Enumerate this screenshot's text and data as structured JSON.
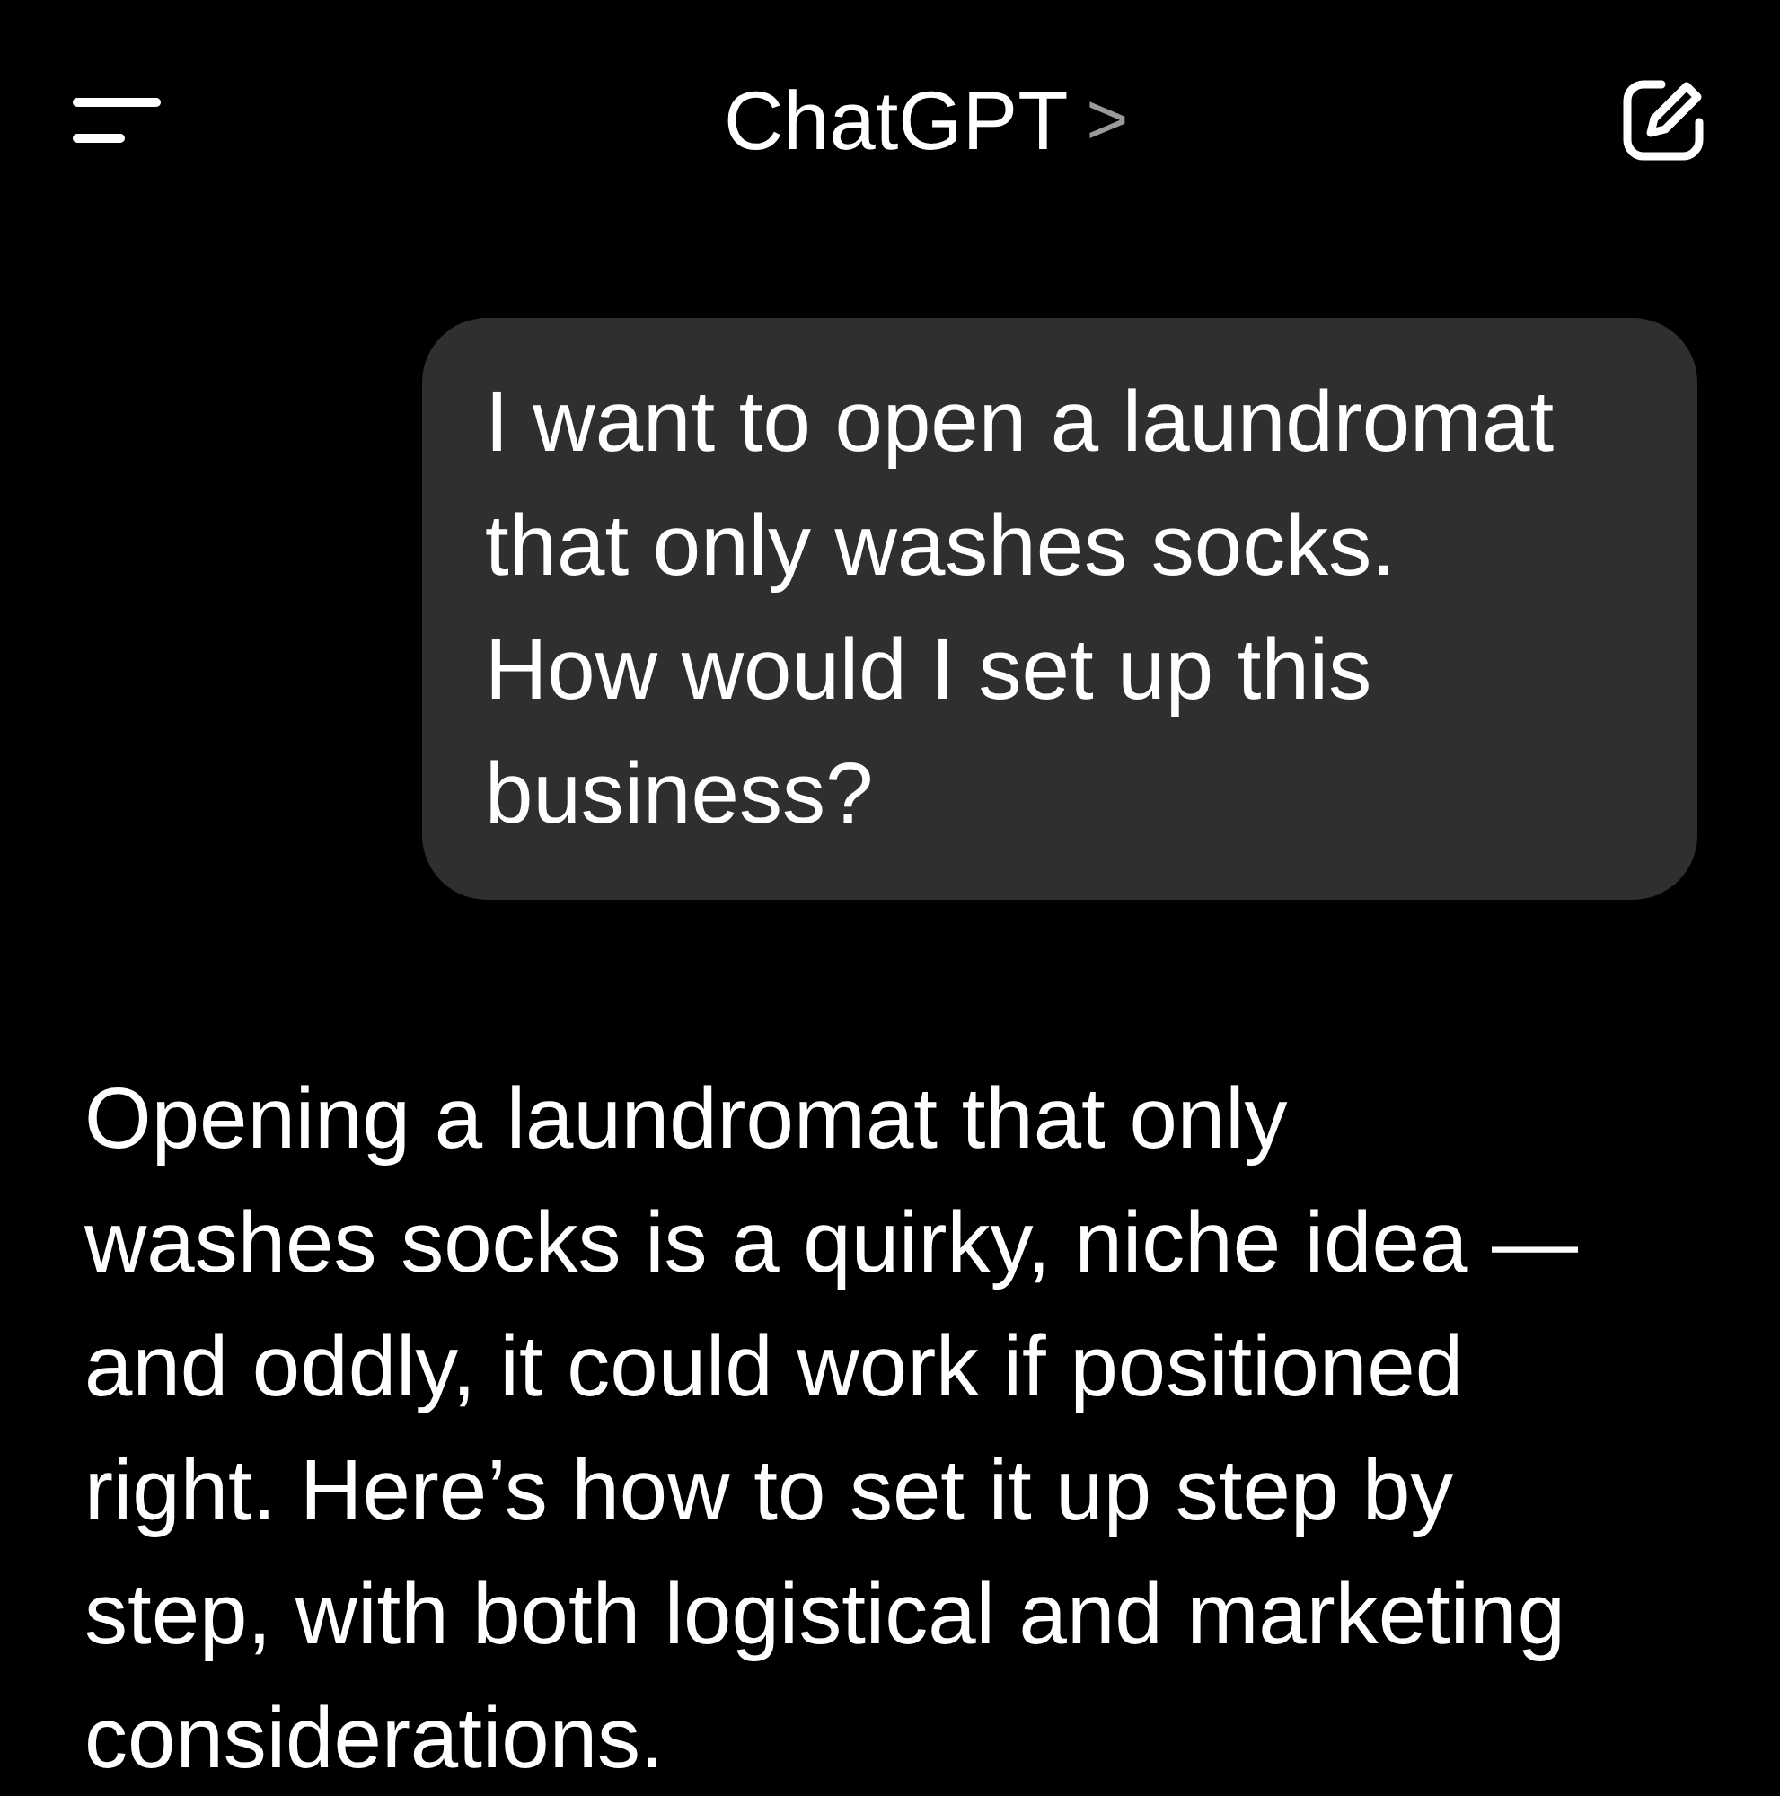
{
  "header": {
    "title": "ChatGPT",
    "chevron": ">"
  },
  "messages": [
    {
      "kind": "user",
      "text": "I want to open a laundromat\nthat only washes socks.\nHow would I set up this\nbusiness?"
    },
    {
      "kind": "assistant",
      "text": "Opening a laundromat that only\nwashes socks is a quirky, niche idea —\nand oddly, it could work if positioned\nright. Here’s how to set it up step by\nstep, with both logistical and marketing\nconsiderations."
    }
  ]
}
